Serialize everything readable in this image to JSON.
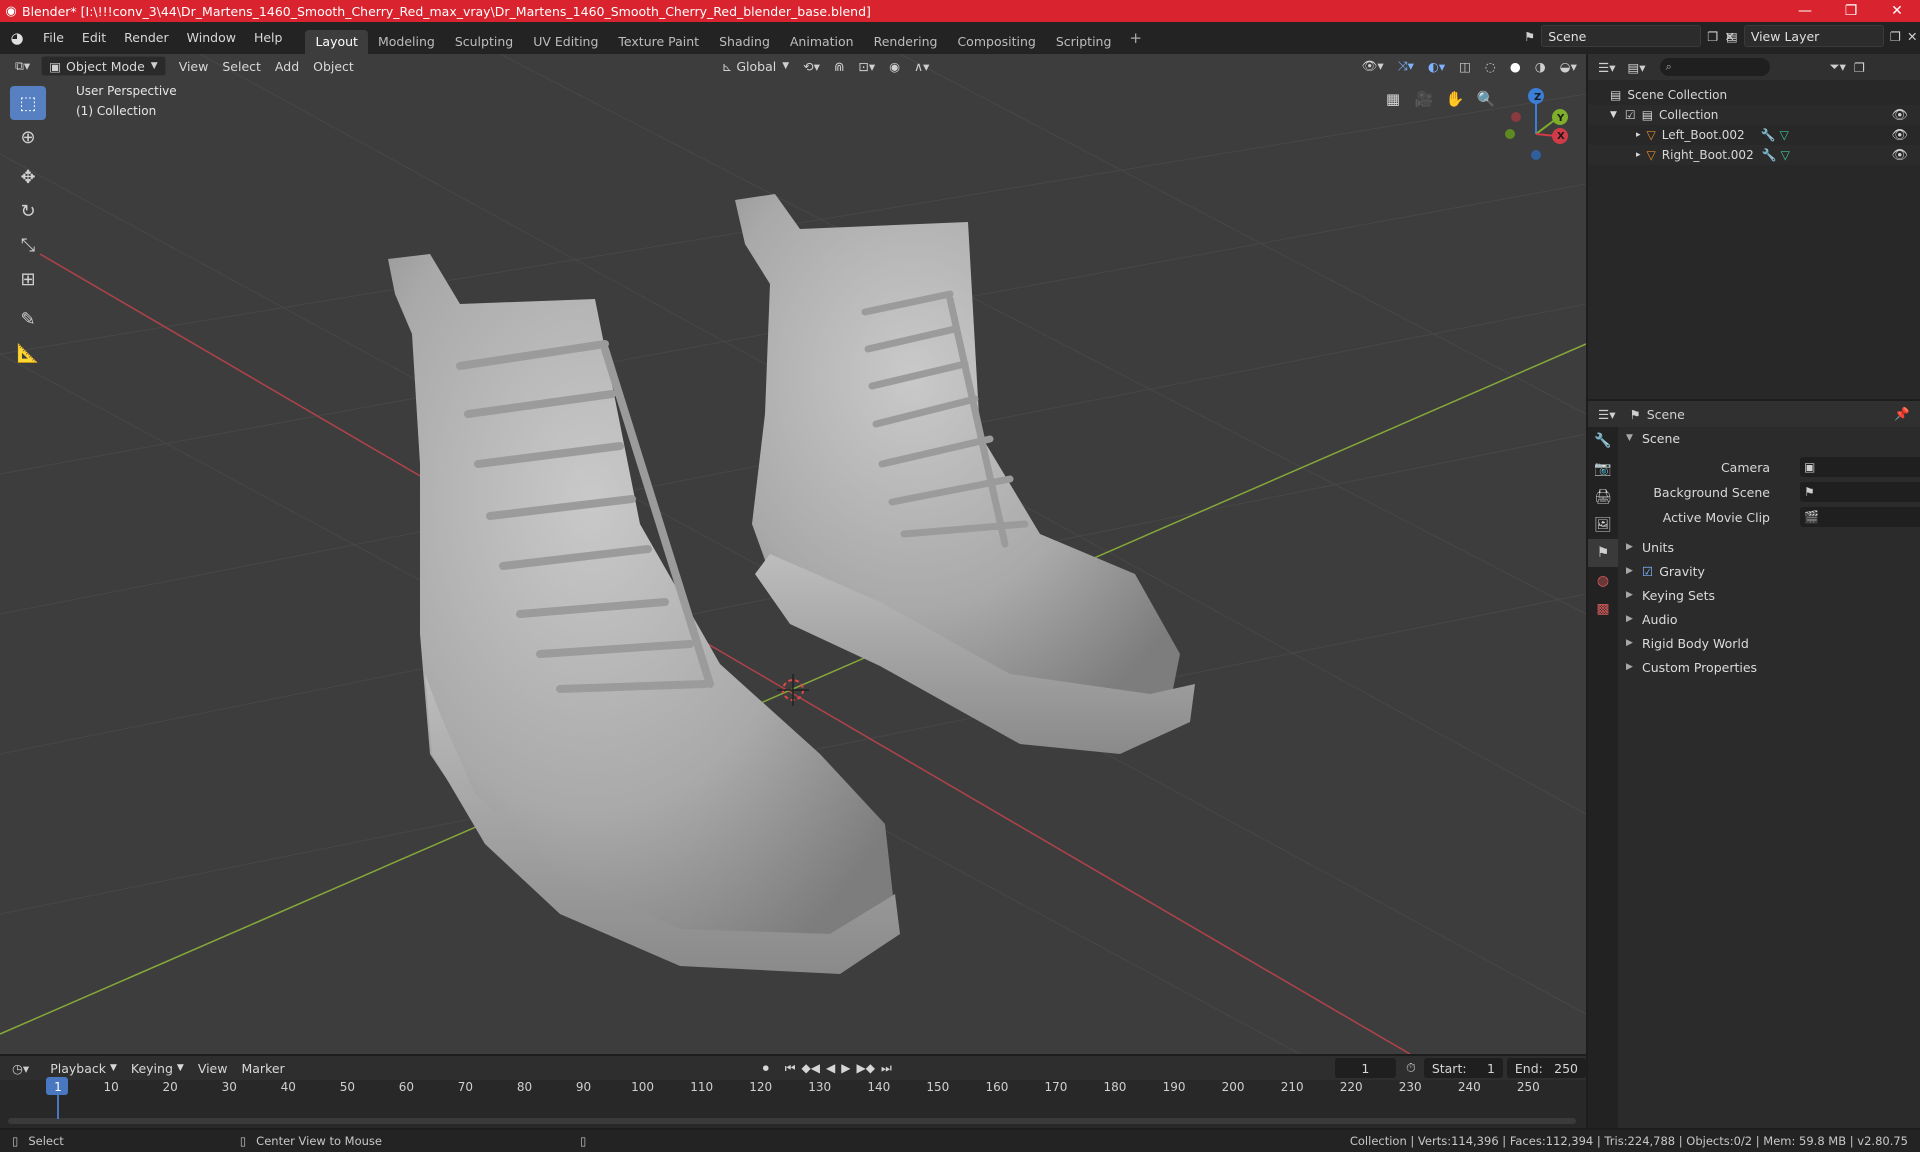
{
  "titlebar": {
    "title": "Blender* [I:\\!!!conv_3\\44\\Dr_Martens_1460_Smooth_Cherry_Red_max_vray\\Dr_Martens_1460_Smooth_Cherry_Red_blender_base.blend]",
    "minimize": "—",
    "maximize": "❐",
    "close": "✕",
    "bg_color": "#d9232e"
  },
  "menubar": {
    "menus": [
      "File",
      "Edit",
      "Render",
      "Window",
      "Help"
    ],
    "workspaces": [
      "Layout",
      "Modeling",
      "Sculpting",
      "UV Editing",
      "Texture Paint",
      "Shading",
      "Animation",
      "Rendering",
      "Compositing",
      "Scripting"
    ],
    "active_workspace": "Layout",
    "add_tab": "+",
    "scene_name": "Scene",
    "view_layer": "View Layer"
  },
  "viewport": {
    "mode": "Object Mode",
    "menus": [
      "View",
      "Select",
      "Add",
      "Object"
    ],
    "transform_orientation": "Global",
    "perspective_label": "User Perspective",
    "collection_label": "(1) Collection",
    "gizmo": {
      "x": "X",
      "y": "Y",
      "z": "Z"
    },
    "grid_color": "#474747",
    "x_axis_color": "#b0434a",
    "y_axis_color": "#86a83a"
  },
  "outliner": {
    "search_placeholder": "",
    "root": "Scene Collection",
    "collection": "Collection",
    "objects": [
      "Left_Boot.002",
      "Right_Boot.002"
    ]
  },
  "properties": {
    "header_title": "Scene",
    "panel_title": "Scene",
    "camera_label": "Camera",
    "background_scene_label": "Background Scene",
    "active_movie_clip_label": "Active Movie Clip",
    "sections": [
      "Units",
      "Gravity",
      "Keying Sets",
      "Audio",
      "Rigid Body World",
      "Custom Properties"
    ]
  },
  "timeline": {
    "menus": [
      "Playback",
      "Keying",
      "View",
      "Marker"
    ],
    "current_frame": "1",
    "start_label": "Start:",
    "start": "1",
    "end_label": "End:",
    "end": "250",
    "ticks": [
      "1",
      "10",
      "20",
      "30",
      "40",
      "50",
      "60",
      "70",
      "80",
      "90",
      "100",
      "110",
      "120",
      "130",
      "140",
      "150",
      "160",
      "170",
      "180",
      "190",
      "200",
      "210",
      "220",
      "230",
      "240",
      "250"
    ]
  },
  "statusbar": {
    "select": "Select",
    "center_view": "Center View to Mouse",
    "stats": "Collection | Verts:114,396 | Faces:112,394 | Tris:224,788 | Objects:0/2 | Mem: 59.8 MB | v2.80.75"
  }
}
